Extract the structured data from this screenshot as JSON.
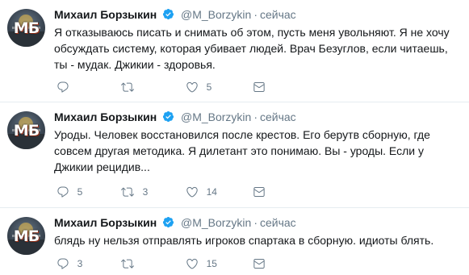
{
  "tweets": [
    {
      "author": {
        "name": "Михаил Борзыкин",
        "handle": "@M_Borzykin",
        "avatar_text": "МБ",
        "verified": true
      },
      "separator": "·",
      "time": "сейчас",
      "text": "Я отказываюсь писать и снимать об этом, пусть меня увольняют. Я не хочу обсуждать систему, которая убивает людей. Врач Безуглов, если читаешь, ты - мудак. Джикии - здоровья.",
      "actions": {
        "reply_count": "",
        "retweet_count": "",
        "like_count": "5"
      }
    },
    {
      "author": {
        "name": "Михаил Борзыкин",
        "handle": "@M_Borzykin",
        "avatar_text": "МБ",
        "verified": true
      },
      "separator": "·",
      "time": "сейчас",
      "text": "Уроды. Человек восстановился после крестов. Его берутв сборную, где совсем другая методика. Я дилетант это понимаю. Вы - уроды. Если у Джикии рецидив...",
      "actions": {
        "reply_count": "5",
        "retweet_count": "3",
        "like_count": "14"
      }
    },
    {
      "author": {
        "name": "Михаил Борзыкин",
        "handle": "@M_Borzykin",
        "avatar_text": "МБ",
        "verified": true
      },
      "separator": "·",
      "time": "сейчас",
      "text": "блядь ну нельзя отправлять игроков спартака в сборную. идиоты блять.",
      "actions": {
        "reply_count": "3",
        "retweet_count": "",
        "like_count": "15"
      }
    }
  ],
  "icons": {
    "reply": "reply-icon",
    "retweet": "retweet-icon",
    "like": "heart-icon",
    "dm": "envelope-icon",
    "verified": "verified-badge-icon"
  },
  "colors": {
    "name": "#14171a",
    "secondary": "#657786",
    "verified": "#1da1f2",
    "divider": "#e6ecf0"
  }
}
